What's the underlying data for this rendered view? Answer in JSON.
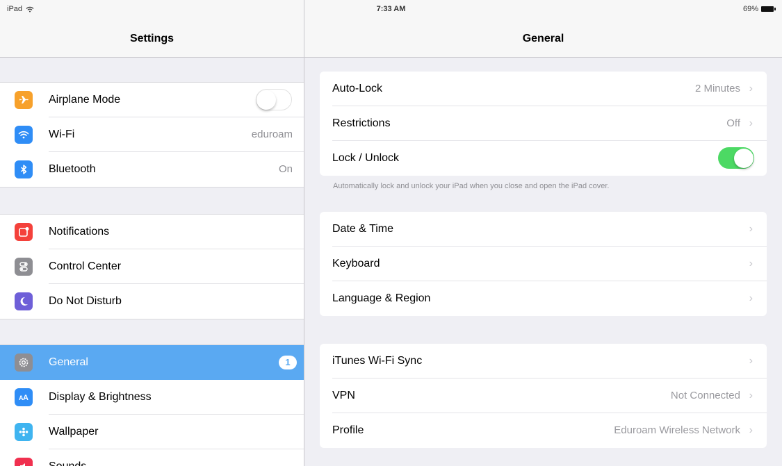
{
  "status_bar": {
    "device": "iPad",
    "time": "7:33 AM",
    "battery": "69%"
  },
  "master": {
    "title": "Settings",
    "group1": [
      {
        "label": "Airplane Mode",
        "icon": "airplane-icon",
        "color": "#f7a12b",
        "toggle": "off"
      },
      {
        "label": "Wi-Fi",
        "icon": "wifi-icon",
        "color": "#2f8df6",
        "value": "eduroam"
      },
      {
        "label": "Bluetooth",
        "icon": "bluetooth-icon",
        "color": "#2f8df6",
        "value": "On"
      }
    ],
    "group2": [
      {
        "label": "Notifications",
        "icon": "notifications-icon",
        "color": "#f4413b"
      },
      {
        "label": "Control Center",
        "icon": "control-center-icon",
        "color": "#8e8e93"
      },
      {
        "label": "Do Not Disturb",
        "icon": "moon-icon",
        "color": "#6e5fd8"
      }
    ],
    "group3": [
      {
        "label": "General",
        "icon": "gear-icon",
        "color": "#8e8e93",
        "badge": "1",
        "selected": true
      },
      {
        "label": "Display & Brightness",
        "icon": "display-icon",
        "color": "#2f8df6"
      },
      {
        "label": "Wallpaper",
        "icon": "wallpaper-icon",
        "color": "#3fb4f0"
      },
      {
        "label": "Sounds",
        "icon": "sounds-icon",
        "color": "#f0304f"
      }
    ]
  },
  "detail": {
    "title": "General",
    "group1": [
      {
        "label": "Auto-Lock",
        "value": "2 Minutes"
      },
      {
        "label": "Restrictions",
        "value": "Off"
      },
      {
        "label": "Lock / Unlock",
        "toggle": "on"
      }
    ],
    "footnote": "Automatically lock and unlock your iPad when you close and open the iPad cover.",
    "group2": [
      {
        "label": "Date & Time"
      },
      {
        "label": "Keyboard"
      },
      {
        "label": "Language & Region"
      }
    ],
    "group3": [
      {
        "label": "iTunes Wi-Fi Sync"
      },
      {
        "label": "VPN",
        "value": "Not Connected"
      },
      {
        "label": "Profile",
        "value": "Eduroam Wireless Network"
      }
    ],
    "chevron": "›"
  },
  "colors": {
    "accent": "#5aa9f2",
    "switch_on": "#4cd964",
    "background": "#efeff4"
  }
}
